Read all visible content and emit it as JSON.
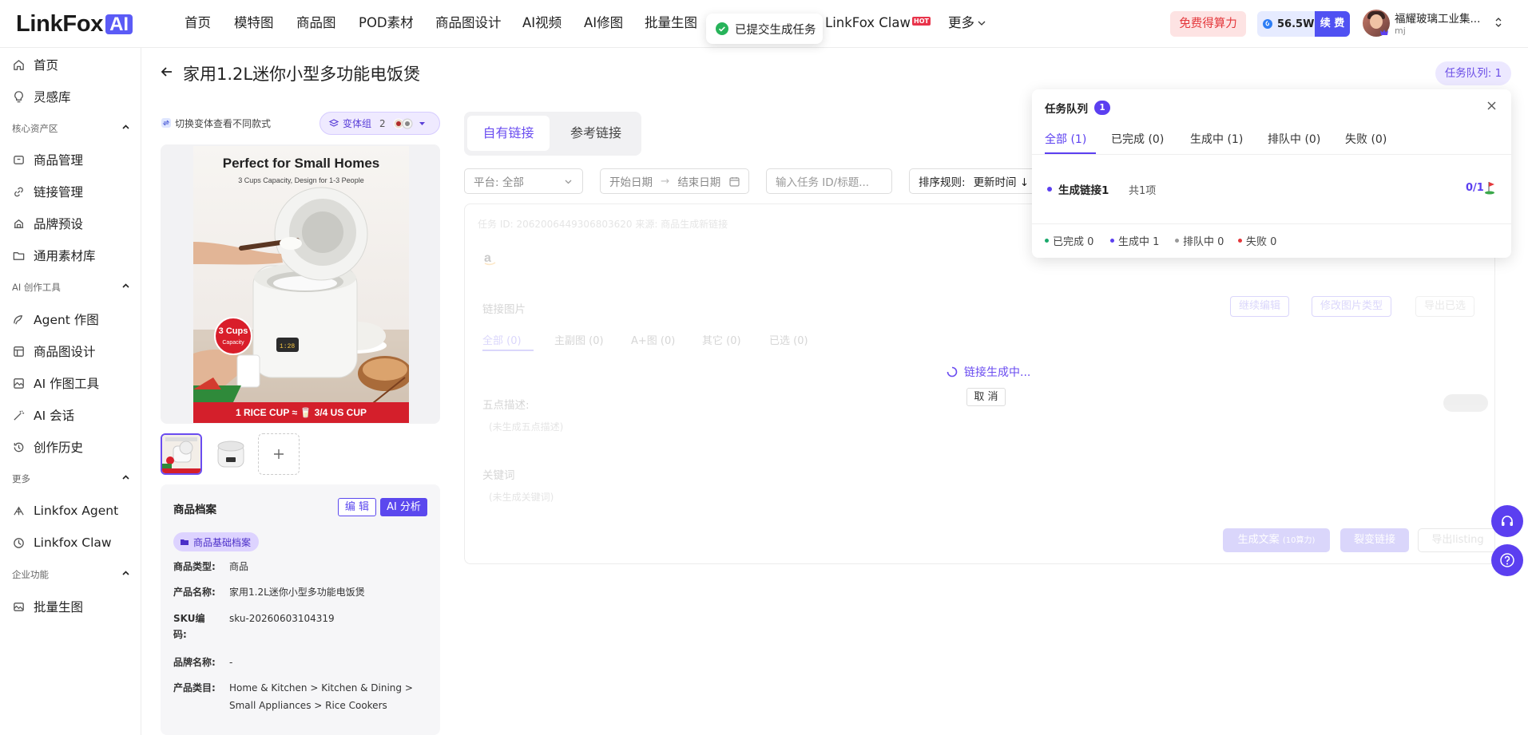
{
  "brand": {
    "name": "LinkFox",
    "badge": "AI"
  },
  "nav": [
    {
      "label": "首页"
    },
    {
      "label": "模特图"
    },
    {
      "label": "商品图"
    },
    {
      "label": "POD素材"
    },
    {
      "label": "商品图设计"
    },
    {
      "label": "AI视频"
    },
    {
      "label": "AI修图"
    },
    {
      "label": "批量生图"
    },
    {
      "label": "LinkFox Claw",
      "hot": "HOT"
    },
    {
      "label": "更多"
    }
  ],
  "toast": {
    "text": "已提交生成任务"
  },
  "header_right": {
    "free_button": "免费得算力",
    "credits": "56.5W",
    "renew": "续 费",
    "user_name": "福耀玻璃工业集...",
    "user_sub": "mj"
  },
  "sidebar": {
    "top": [
      {
        "label": "首页",
        "icon": "home-icon"
      },
      {
        "label": "灵感库",
        "icon": "bulb-icon"
      }
    ],
    "sections": [
      {
        "title": "核心资产区",
        "items": [
          {
            "label": "商品管理",
            "icon": "box-icon"
          },
          {
            "label": "链接管理",
            "icon": "link-icon"
          },
          {
            "label": "品牌预设",
            "icon": "brand-icon"
          },
          {
            "label": "通用素材库",
            "icon": "folder-icon"
          }
        ]
      },
      {
        "title": "AI 创作工具",
        "items": [
          {
            "label": "Agent 作图",
            "icon": "agent-icon"
          },
          {
            "label": "商品图设计",
            "icon": "layout-icon"
          },
          {
            "label": "AI 作图工具",
            "icon": "image-tool-icon"
          },
          {
            "label": "AI 会话",
            "icon": "magic-wand-icon"
          },
          {
            "label": "创作历史",
            "icon": "history-icon"
          }
        ]
      },
      {
        "title": "更多",
        "items": [
          {
            "label": "Linkfox Agent",
            "icon": "agent-logo-icon"
          },
          {
            "label": "Linkfox Claw",
            "icon": "claw-icon"
          }
        ]
      },
      {
        "title": "企业功能",
        "items": [
          {
            "label": "批量生图",
            "icon": "batch-image-icon"
          }
        ]
      }
    ]
  },
  "page": {
    "title": "家用1.2L迷你小型多功能电饭煲",
    "queue_pill": "任务队列: 1"
  },
  "product": {
    "switch_hint": "切换变体查看不同款式",
    "variant_group": {
      "label": "变体组",
      "count": "2"
    },
    "image": {
      "headline": "Perfect for Small Homes",
      "subline": "3 Cups Capacity, Design for 1-3 People",
      "cups_badge": "3 Cups",
      "cups_badge_sub": "Capacity",
      "banner": "1 RICE CUP ≈ 🥛 3/4 US CUP"
    },
    "profile": {
      "title": "商品档案",
      "edit": "编 辑",
      "ai": "AI 分析",
      "badge": "商品基础档案",
      "fields": [
        {
          "key": "商品类型:",
          "value": "商品"
        },
        {
          "key": "产品名称:",
          "value": "家用1.2L迷你小型多功能电饭煲"
        },
        {
          "key": "SKU编码:",
          "value": "sku-20260603104319"
        },
        {
          "key": "品牌名称:",
          "value": "-"
        },
        {
          "key": "产品类目:",
          "value": "Home & Kitchen > Kitchen & Dining > Small Appliances > Rice Cookers"
        }
      ]
    }
  },
  "main": {
    "tabs": [
      {
        "label": "自有链接"
      },
      {
        "label": "参考链接"
      }
    ],
    "filters": {
      "platform": "平台: 全部",
      "start_date": "开始日期",
      "end_date": "结束日期",
      "task_placeholder": "输入任务 ID/标题...",
      "sort_label": "排序规则:",
      "sort_value": "更新时间 ↓"
    },
    "card": {
      "meta": "任务 ID: 2062006449306803620  来源: 商品生成新链接",
      "images_label": "链接图片",
      "btn_continue": "继续编辑",
      "btn_change_type": "修改图片类型",
      "btn_export": "导出已选",
      "img_tabs": [
        "全部 (0)",
        "主副图 (0)",
        "A+图 (0)",
        "其它 (0)",
        "已选 (0)"
      ],
      "bullets_label": "五点描述:",
      "bullets_placeholder": "(未生成五点描述)",
      "keywords_label": "关键词",
      "keywords_placeholder": "(未生成关键词)",
      "btn_gen_copy": "生成文案",
      "btn_gen_copy_sub": "(10算力)",
      "btn_split": "裂变链接",
      "btn_export_listing": "导出listing",
      "loading": "链接生成中...",
      "cancel": "取 消"
    }
  },
  "task_queue": {
    "title": "任务队列",
    "count": "1",
    "tabs": [
      "全部 (1)",
      "已完成 (0)",
      "生成中 (1)",
      "排队中 (0)",
      "失败 (0)"
    ],
    "row": {
      "name": "生成链接1",
      "total": "共1项",
      "progress": "0/1"
    },
    "stats": [
      {
        "label": "已完成 0",
        "color": "#1aa86b"
      },
      {
        "label": "生成中 1",
        "color": "#5b3ff0"
      },
      {
        "label": "排队中 0",
        "color": "#999999"
      },
      {
        "label": "失败 0",
        "color": "#e4373b"
      }
    ]
  },
  "colors": {
    "accent": "#5b3ff0",
    "danger": "#e4373b"
  }
}
